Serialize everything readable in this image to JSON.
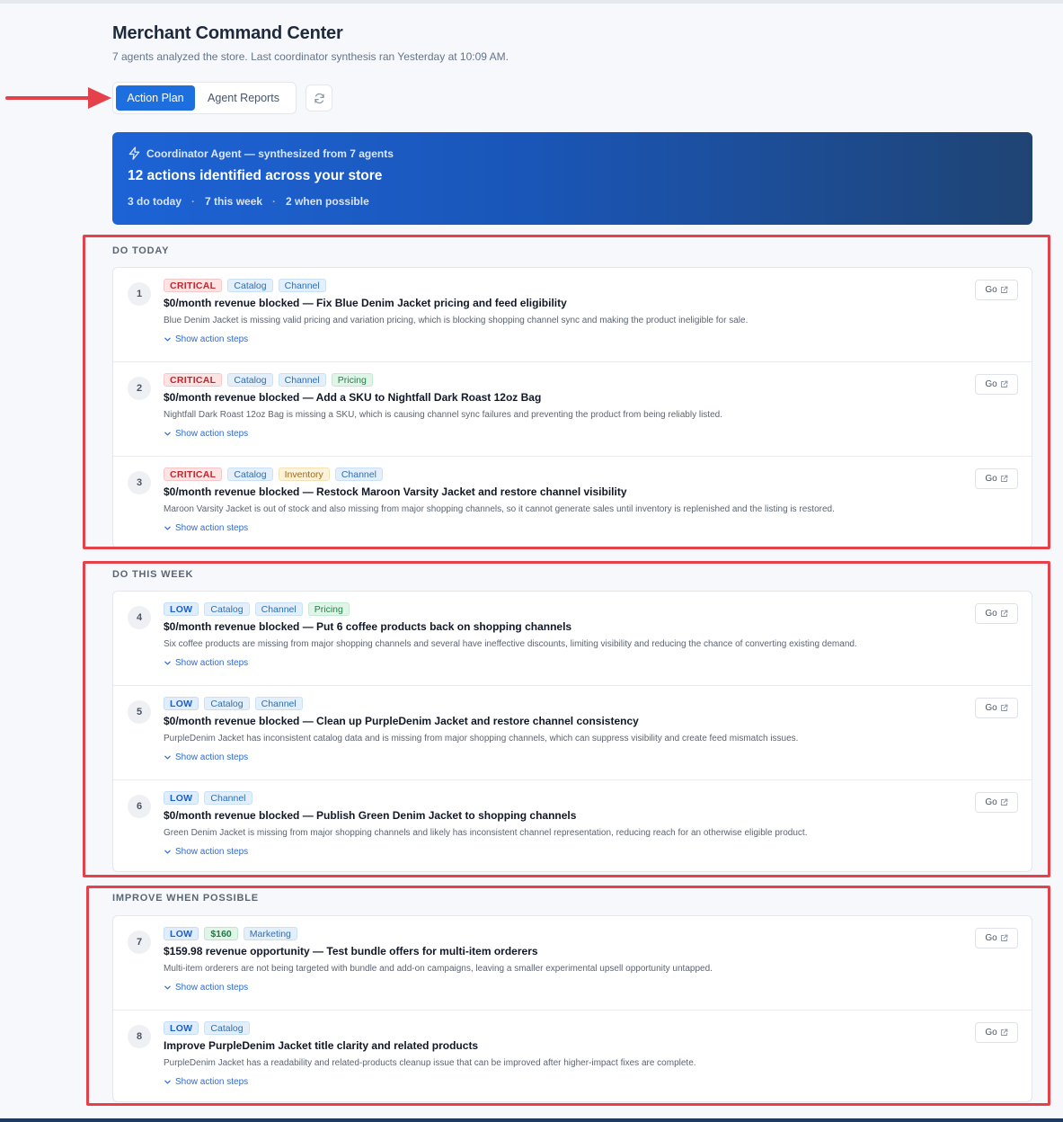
{
  "header": {
    "title": "Merchant Command Center",
    "subtitle": "7 agents analyzed the store. Last coordinator synthesis ran Yesterday at 10:09 AM."
  },
  "tabs": [
    {
      "label": "Action Plan",
      "active": true
    },
    {
      "label": "Agent Reports",
      "active": false
    }
  ],
  "refresh_icon": "refresh-icon",
  "coordinator": {
    "source": "Coordinator Agent — synthesized from 7 agents",
    "headline": "12 actions identified across your store",
    "stats": [
      "3 do today",
      "7 this week",
      "2 when possible"
    ],
    "separator": "·"
  },
  "sections": [
    {
      "label": "DO TODAY",
      "items": [
        {
          "num": "1",
          "badges": [
            {
              "text": "CRITICAL",
              "kind": "critical"
            },
            {
              "text": "Catalog",
              "kind": "catalog"
            },
            {
              "text": "Channel",
              "kind": "channel"
            }
          ],
          "title": "$0/month revenue blocked — Fix Blue Denim Jacket pricing and feed eligibility",
          "desc": "Blue Denim Jacket is missing valid pricing and variation pricing, which is blocking shopping channel sync and making the product ineligible for sale.",
          "steps": "Show action steps",
          "go": "Go"
        },
        {
          "num": "2",
          "badges": [
            {
              "text": "CRITICAL",
              "kind": "critical"
            },
            {
              "text": "Catalog",
              "kind": "catalog"
            },
            {
              "text": "Channel",
              "kind": "channel"
            },
            {
              "text": "Pricing",
              "kind": "pricing"
            }
          ],
          "title": "$0/month revenue blocked — Add a SKU to Nightfall Dark Roast 12oz Bag",
          "desc": "Nightfall Dark Roast 12oz Bag is missing a SKU, which is causing channel sync failures and preventing the product from being reliably listed.",
          "steps": "Show action steps",
          "go": "Go"
        },
        {
          "num": "3",
          "badges": [
            {
              "text": "CRITICAL",
              "kind": "critical"
            },
            {
              "text": "Catalog",
              "kind": "catalog"
            },
            {
              "text": "Inventory",
              "kind": "inventory"
            },
            {
              "text": "Channel",
              "kind": "channel"
            }
          ],
          "title": "$0/month revenue blocked — Restock Maroon Varsity Jacket and restore channel visibility",
          "desc": "Maroon Varsity Jacket is out of stock and also missing from major shopping channels, so it cannot generate sales until inventory is replenished and the listing is restored.",
          "steps": "Show action steps",
          "go": "Go"
        }
      ]
    },
    {
      "label": "DO THIS WEEK",
      "items": [
        {
          "num": "4",
          "badges": [
            {
              "text": "LOW",
              "kind": "low"
            },
            {
              "text": "Catalog",
              "kind": "catalog"
            },
            {
              "text": "Channel",
              "kind": "channel"
            },
            {
              "text": "Pricing",
              "kind": "pricing"
            }
          ],
          "title": "$0/month revenue blocked — Put 6 coffee products back on shopping channels",
          "desc": "Six coffee products are missing from major shopping channels and several have ineffective discounts, limiting visibility and reducing the chance of converting existing demand.",
          "steps": "Show action steps",
          "go": "Go"
        },
        {
          "num": "5",
          "badges": [
            {
              "text": "LOW",
              "kind": "low"
            },
            {
              "text": "Catalog",
              "kind": "catalog"
            },
            {
              "text": "Channel",
              "kind": "channel"
            }
          ],
          "title": "$0/month revenue blocked — Clean up PurpleDenim Jacket and restore channel consistency",
          "desc": "PurpleDenim Jacket has inconsistent catalog data and is missing from major shopping channels, which can suppress visibility and create feed mismatch issues.",
          "steps": "Show action steps",
          "go": "Go"
        },
        {
          "num": "6",
          "badges": [
            {
              "text": "LOW",
              "kind": "low"
            },
            {
              "text": "Channel",
              "kind": "channel"
            }
          ],
          "title": "$0/month revenue blocked — Publish Green Denim Jacket to shopping channels",
          "desc": "Green Denim Jacket is missing from major shopping channels and likely has inconsistent channel representation, reducing reach for an otherwise eligible product.",
          "steps": "Show action steps",
          "go": "Go"
        }
      ]
    },
    {
      "label": "IMPROVE WHEN POSSIBLE",
      "items": [
        {
          "num": "7",
          "badges": [
            {
              "text": "LOW",
              "kind": "low"
            },
            {
              "text": "$160",
              "kind": "money"
            },
            {
              "text": "Marketing",
              "kind": "marketing"
            }
          ],
          "title": "$159.98 revenue opportunity — Test bundle offers for multi-item orderers",
          "desc": "Multi-item orderers are not being targeted with bundle and add-on campaigns, leaving a smaller experimental upsell opportunity untapped.",
          "steps": "Show action steps",
          "go": "Go"
        },
        {
          "num": "8",
          "badges": [
            {
              "text": "LOW",
              "kind": "low"
            },
            {
              "text": "Catalog",
              "kind": "catalog"
            }
          ],
          "title": "Improve PurpleDenim Jacket title clarity and related products",
          "desc": "PurpleDenim Jacket has a readability and related-products cleanup issue that can be improved after higher-impact fixes are complete.",
          "steps": "Show action steps",
          "go": "Go"
        }
      ]
    }
  ],
  "colors": {
    "primary": "#1d6fe0",
    "annotation_red": "#e5414a",
    "banner_start": "#1d63d6",
    "banner_end": "#1f4474"
  }
}
